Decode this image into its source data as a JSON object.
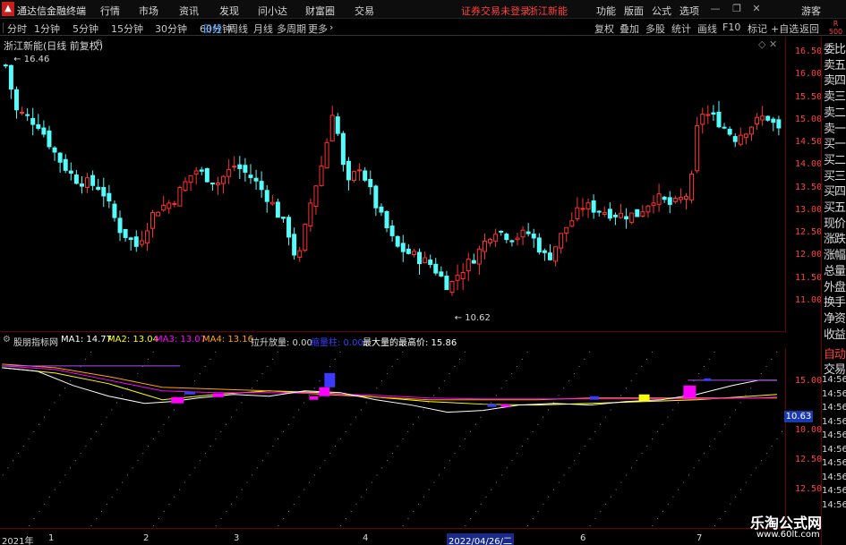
{
  "titlebar": {
    "app_title": "通达信金融终端",
    "menus": [
      "行情",
      "市场",
      "资讯",
      "发现",
      "问小达",
      "财富圈",
      "交易"
    ],
    "login_status": "证券交易未登录",
    "stock_tag": "浙江新能",
    "right_menus": [
      "功能",
      "版面",
      "公式",
      "选项"
    ],
    "guest": "游客"
  },
  "toolbar": {
    "periods": [
      "分时",
      "1分钟",
      "5分钟",
      "15分钟",
      "30分钟",
      "60分钟",
      "日线",
      "周线",
      "月线",
      "多周期",
      "更多"
    ],
    "active_period": "日线",
    "buttons": [
      "复权",
      "叠加",
      "多股",
      "统计",
      "画线",
      "F10",
      "标记",
      "+自选",
      "返回"
    ],
    "badge_top": "R",
    "badge_bottom": "500"
  },
  "main_chart": {
    "stock_label": "浙江新能(日线 前复权)",
    "high_label": "16.46",
    "low_label": "10.62",
    "price_ticks": [
      "16.50",
      "16.00",
      "15.50",
      "15.00",
      "14.50",
      "14.00",
      "13.50",
      "13.00",
      "12.50",
      "12.00",
      "11.50",
      "11.00"
    ],
    "up_color": "#ff3232",
    "down_color": "#54fcfc"
  },
  "side_panel": {
    "items": [
      "委比",
      "卖五",
      "卖四",
      "卖三",
      "卖二",
      "卖一",
      "买一",
      "买二",
      "买三",
      "买四",
      "买五",
      "现价",
      "涨跌",
      "涨幅",
      "总量",
      "外盘",
      "换手",
      "净资",
      "收益"
    ],
    "lower_items": [
      "自动",
      "交易"
    ],
    "time_ticks": [
      "14:56",
      "14:56",
      "14:56",
      "14:56",
      "14:56",
      "14:56",
      "14:56",
      "14:56",
      "14:56",
      "14:56"
    ]
  },
  "indicator": {
    "name": "股朋指标网",
    "ma1": "MA1: 14.77",
    "ma2": "MA2: 13.04",
    "ma3": "MA3: 13.07",
    "ma4": "MA4: 13.16",
    "lift": "拉升放量: 0.00",
    "shrink": "缩量柱: 0.00",
    "max_price": "最大量的最高价: 15.86",
    "ticks": [
      "15.00",
      "12.50",
      "10.00",
      "12.50"
    ],
    "value_box": "10.63",
    "ma1_color": "#ffffff",
    "ma2_color": "#ffff00",
    "ma3_color": "#ff00ff",
    "ma4_color": "#ffa500"
  },
  "time_axis": {
    "labels": [
      "2021年",
      "1",
      "2",
      "3",
      "4",
      "6",
      "7"
    ],
    "cursor_date": "2022/04/26/二"
  },
  "watermark": {
    "line1": "乐淘公式网",
    "line2": "www.60lt.com"
  }
}
